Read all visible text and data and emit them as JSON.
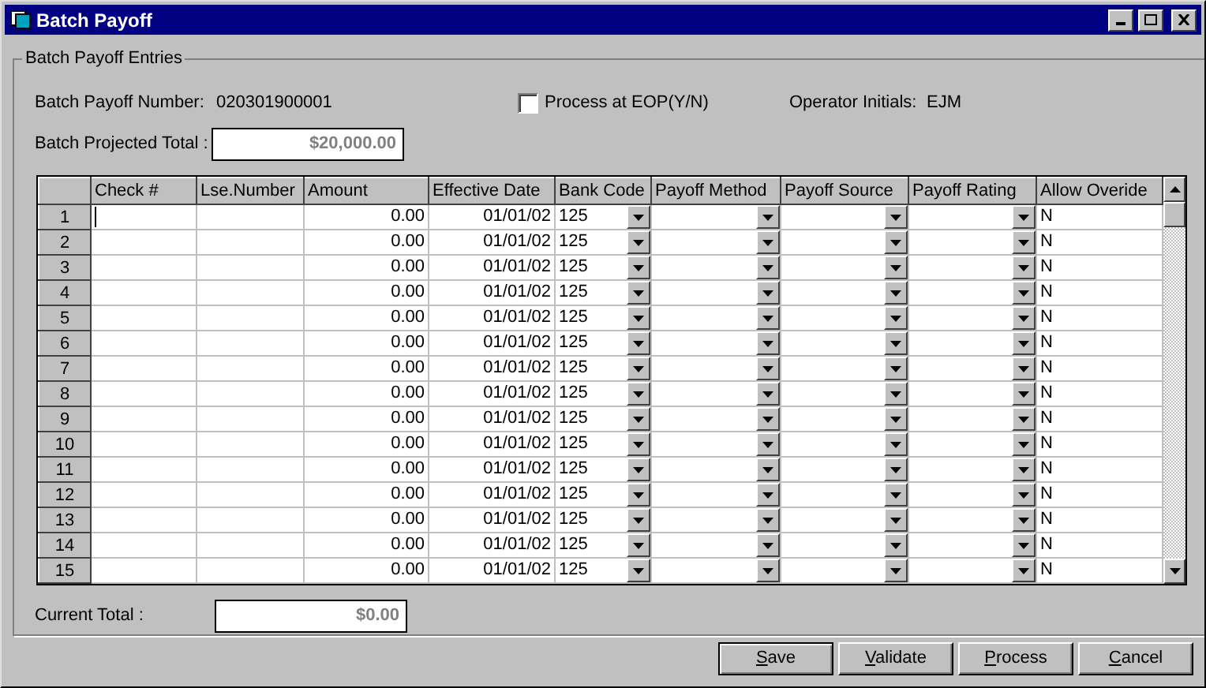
{
  "window": {
    "title": "Batch Payoff"
  },
  "group": {
    "title": "Batch Payoff Entries"
  },
  "batch_number": {
    "label": "Batch Payoff Number:",
    "value": "020301900001"
  },
  "process_at_eop": {
    "label": "Process at EOP(Y/N)",
    "checked": false
  },
  "operator": {
    "label": "Operator Initials:",
    "value": "EJM"
  },
  "projected_total": {
    "label": "Batch Projected Total :",
    "value": "$20,000.00",
    "disabled": true
  },
  "table": {
    "columns": [
      {
        "label": "Check #",
        "kind": "text"
      },
      {
        "label": "Lse.Number",
        "kind": "text"
      },
      {
        "label": "Amount",
        "kind": "number"
      },
      {
        "label": "Effective Date",
        "kind": "number"
      },
      {
        "label": "Bank Code",
        "kind": "dropdown"
      },
      {
        "label": "Payoff Method",
        "kind": "dropdown"
      },
      {
        "label": "Payoff Source",
        "kind": "dropdown"
      },
      {
        "label": "Payoff Rating",
        "kind": "dropdown"
      },
      {
        "label": "Allow Overide",
        "kind": "text"
      }
    ],
    "rows": [
      {
        "header": "1",
        "editing": true,
        "amount": "0.00",
        "effective_date": "01/01/02",
        "bank_code": "125",
        "allow_override": "N"
      },
      {
        "header": "2",
        "editing": false,
        "amount": "0.00",
        "effective_date": "01/01/02",
        "bank_code": "125",
        "allow_override": "N"
      },
      {
        "header": "3",
        "editing": false,
        "amount": "0.00",
        "effective_date": "01/01/02",
        "bank_code": "125",
        "allow_override": "N"
      },
      {
        "header": "4",
        "editing": false,
        "amount": "0.00",
        "effective_date": "01/01/02",
        "bank_code": "125",
        "allow_override": "N"
      },
      {
        "header": "5",
        "editing": false,
        "amount": "0.00",
        "effective_date": "01/01/02",
        "bank_code": "125",
        "allow_override": "N"
      },
      {
        "header": "6",
        "editing": false,
        "amount": "0.00",
        "effective_date": "01/01/02",
        "bank_code": "125",
        "allow_override": "N"
      },
      {
        "header": "7",
        "editing": false,
        "amount": "0.00",
        "effective_date": "01/01/02",
        "bank_code": "125",
        "allow_override": "N"
      },
      {
        "header": "8",
        "editing": false,
        "amount": "0.00",
        "effective_date": "01/01/02",
        "bank_code": "125",
        "allow_override": "N"
      },
      {
        "header": "9",
        "editing": false,
        "amount": "0.00",
        "effective_date": "01/01/02",
        "bank_code": "125",
        "allow_override": "N"
      },
      {
        "header": "10",
        "editing": false,
        "amount": "0.00",
        "effective_date": "01/01/02",
        "bank_code": "125",
        "allow_override": "N"
      },
      {
        "header": "11",
        "editing": false,
        "amount": "0.00",
        "effective_date": "01/01/02",
        "bank_code": "125",
        "allow_override": "N"
      },
      {
        "header": "12",
        "editing": false,
        "amount": "0.00",
        "effective_date": "01/01/02",
        "bank_code": "125",
        "allow_override": "N"
      },
      {
        "header": "13",
        "editing": false,
        "amount": "0.00",
        "effective_date": "01/01/02",
        "bank_code": "125",
        "allow_override": "N"
      },
      {
        "header": "14",
        "editing": false,
        "amount": "0.00",
        "effective_date": "01/01/02",
        "bank_code": "125",
        "allow_override": "N"
      },
      {
        "header": "15",
        "editing": false,
        "amount": "0.00",
        "effective_date": "01/01/02",
        "bank_code": "125",
        "allow_override": "N"
      }
    ]
  },
  "current_total": {
    "label": "Current Total :",
    "value": "$0.00",
    "disabled": true
  },
  "buttons": [
    {
      "label": "Save",
      "default": true
    },
    {
      "label": "Validate",
      "default": false
    },
    {
      "label": "Process",
      "default": false
    },
    {
      "label": "Cancel",
      "default": false
    }
  ]
}
